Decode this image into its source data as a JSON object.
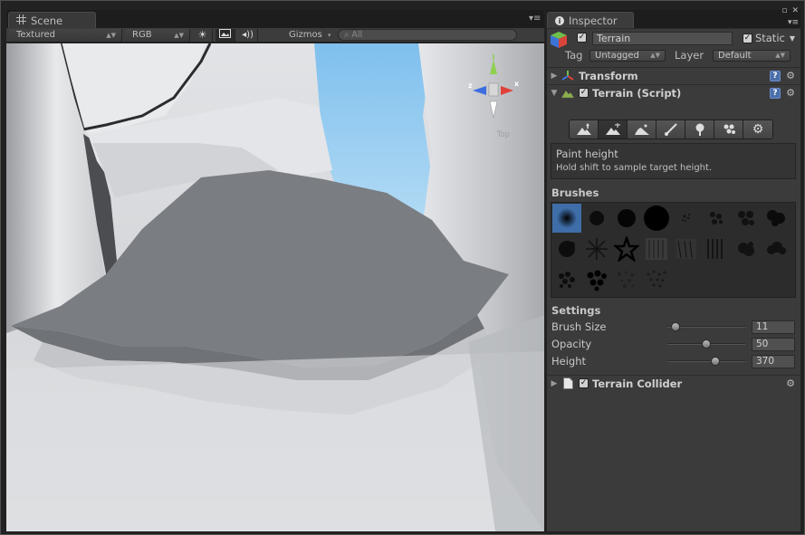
{
  "scene": {
    "tab_label": "Scene",
    "toolbar": {
      "draw_mode": "Textured",
      "render_mode": "RGB",
      "gizmos_label": "Gizmos",
      "search_placeholder": "All"
    },
    "gizmo": {
      "x_label": "x",
      "z_label": "z",
      "projection": "Top"
    }
  },
  "inspector": {
    "tab_label": "Inspector",
    "game_object": {
      "active_checked": true,
      "name": "Terrain",
      "static_label": "Static",
      "static_checked": true,
      "tag_label": "Tag",
      "tag_value": "Untagged",
      "layer_label": "Layer",
      "layer_value": "Default"
    },
    "components": [
      {
        "title": "Transform",
        "expanded": false
      },
      {
        "title": "Terrain (Script)",
        "expanded": true,
        "enabled": true
      },
      {
        "title": "Terrain Collider",
        "expanded": false,
        "enabled": true
      }
    ],
    "terrain_tools": {
      "active_index": 1,
      "tools": [
        "raise-lower-terrain",
        "paint-height",
        "smooth-height",
        "paint-texture",
        "place-trees",
        "paint-details",
        "terrain-settings"
      ]
    },
    "info": {
      "title": "Paint height",
      "hint": "Hold shift to sample target height."
    },
    "brushes_label": "Brushes",
    "brushes_selected_index": 0,
    "settings_label": "Settings",
    "settings": [
      {
        "label": "Brush Size",
        "value": "11",
        "slider_fraction": 0.11
      },
      {
        "label": "Opacity",
        "value": "50",
        "slider_fraction": 0.5
      },
      {
        "label": "Height",
        "value": "370",
        "slider_fraction": 0.62
      }
    ]
  },
  "colors": {
    "accent_selection": "#3f6da8",
    "panel_bg": "#3b3b3b",
    "sky_blue": "#8ec8ef",
    "terrain_flat": "#7a7d82"
  }
}
